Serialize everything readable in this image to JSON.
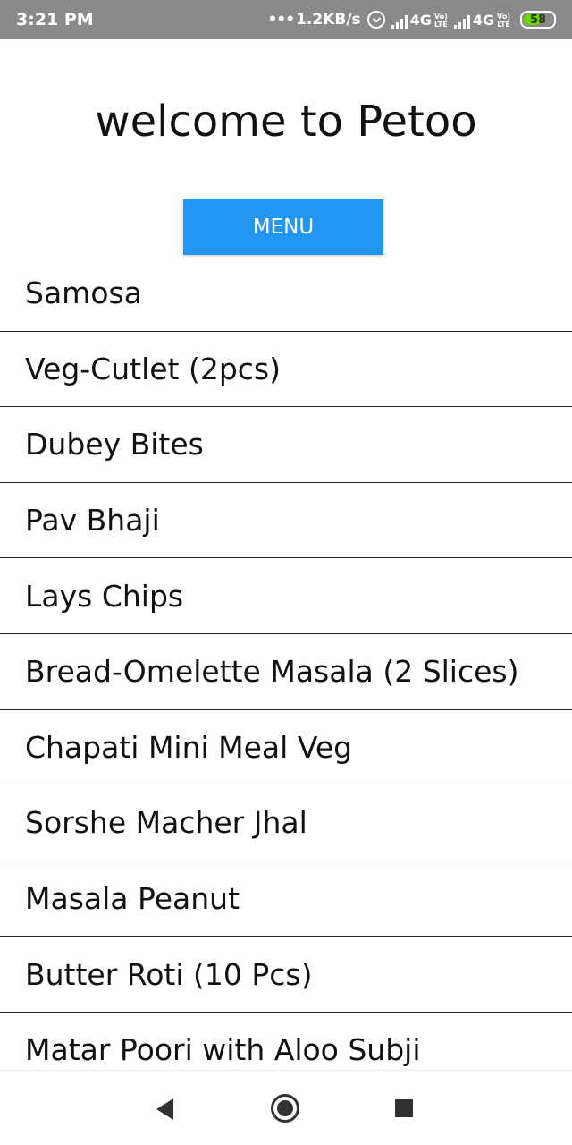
{
  "status_bar": {
    "time": "3:21 PM",
    "net_speed": "1.2KB/s",
    "network_type_1": "4G",
    "network_type_1_suffix": "+",
    "network_type_2": "4G",
    "volte_top": "Vo)",
    "volte_bottom": "LTE",
    "battery_level": "58",
    "battery_percent": 58,
    "battery_color": "#6dd400",
    "bar_color": "#8a8a8a"
  },
  "header": {
    "title": "welcome to Petoo"
  },
  "menu_button": {
    "label": "MENU",
    "color": "#2196f3"
  },
  "menu_items": [
    "Samosa",
    "Veg-Cutlet (2pcs)",
    "Dubey Bites",
    "Pav Bhaji",
    "Lays Chips",
    "Bread-Omelette Masala (2 Slices)",
    "Chapati Mini Meal Veg",
    "Sorshe Macher Jhal",
    "Masala Peanut",
    "Butter Roti (10 Pcs)",
    "Matar Poori with Aloo Subji"
  ],
  "nav_bar": {
    "back_icon": "back-triangle-icon",
    "home_icon": "home-circle-icon",
    "recents_icon": "recents-square-icon"
  }
}
